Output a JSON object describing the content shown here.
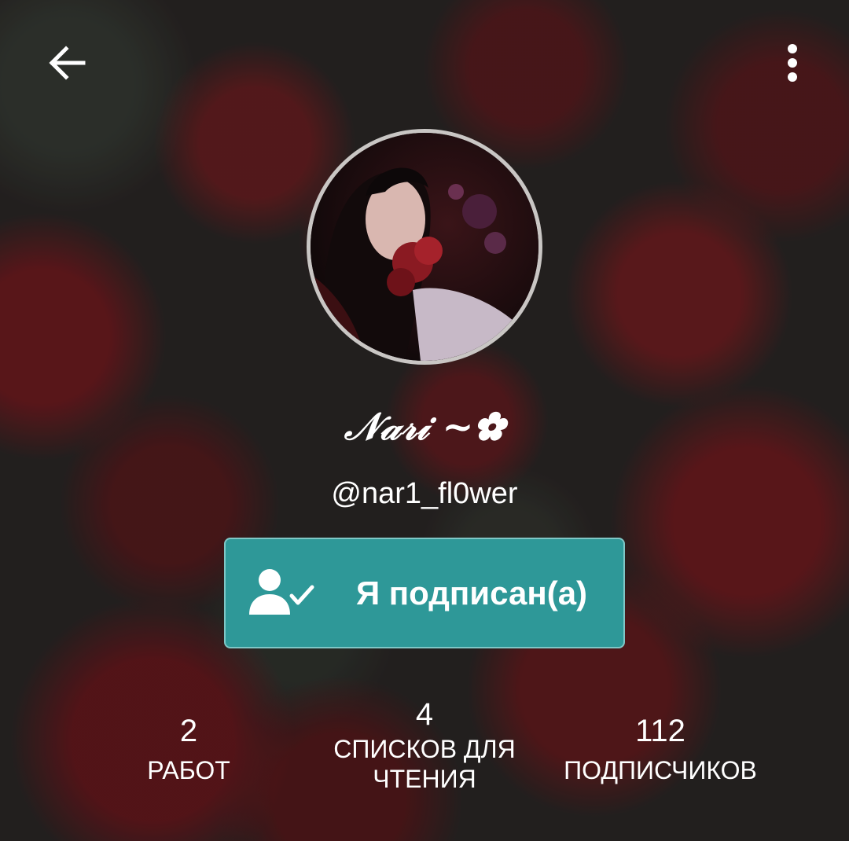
{
  "header": {
    "back_icon": "arrow-left-icon",
    "menu_icon": "more-vertical-icon"
  },
  "profile": {
    "display_name": "𝒩𝒶𝓇𝒾 ~✿",
    "username": "@nar1_fl0wer",
    "avatar": "profile photo"
  },
  "follow_button": {
    "label": "Я подписан(а)",
    "icon": "user-check-icon",
    "color": "#2e9898"
  },
  "stats": [
    {
      "value": "2",
      "label": "РАБОТ"
    },
    {
      "value": "4",
      "label_line1": "СПИСКОВ ДЛЯ",
      "label_line2": "ЧТЕНИЯ"
    },
    {
      "value": "112",
      "label": "ПОДПИСЧИКОВ"
    }
  ]
}
